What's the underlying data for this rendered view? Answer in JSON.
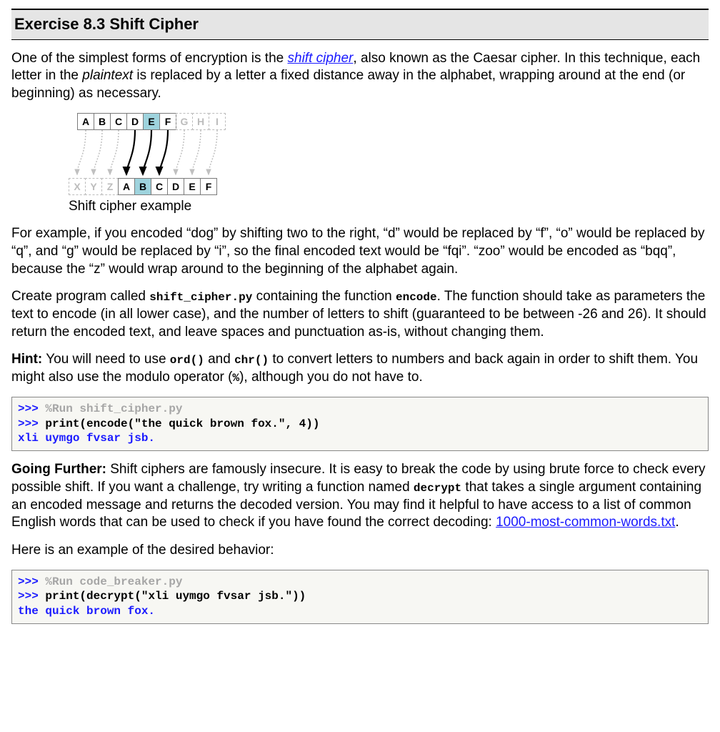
{
  "title": "Exercise 8.3 Shift Cipher",
  "para1": {
    "t1": "One of the simplest forms of encryption is the ",
    "link1": "shift cipher",
    "t2": ", also known as the Caesar cipher. In this technique, each letter in the ",
    "ital1": "plaintext",
    "t3": " is replaced by a letter a fixed distance away in the alphabet, wrapping around at the end (or beginning) as necessary."
  },
  "figure": {
    "top": [
      "A",
      "B",
      "C",
      "D",
      "E",
      "F",
      "G",
      "H",
      "I"
    ],
    "bot": [
      "X",
      "Y",
      "Z",
      "A",
      "B",
      "C",
      "D",
      "E",
      "F"
    ],
    "caption": "Shift cipher example"
  },
  "para2": "For example, if you encoded “dog” by shifting two to the right, “d” would be replaced by “f”, “o” would be replaced by “q”, and “g” would be replaced by “i”, so the final encoded text would be “fqi”. “zoo” would be encoded as “bqq”, because the “z” would wrap around to the beginning of the alphabet again.",
  "para3": {
    "t1": "Create program called ",
    "code1": "shift_cipher.py",
    "t2": " containing the function ",
    "code2": "encode",
    "t3": ". The function should take as parameters the text to encode (in all lower case), and the number of letters to shift (guaranteed to be between -26 and 26). It should return the encoded text, and leave spaces and punctuation as-is, without changing them."
  },
  "hint": {
    "label": "Hint:",
    "t1": " You will need to use ",
    "code1": "ord()",
    "t2": " and ",
    "code2": "chr()",
    "t3": " to convert letters to numbers and back again in order to shift them. You might also use the modulo operator (",
    "code3": "%",
    "t4": "), although you do not have to."
  },
  "code1": {
    "l1_prompt": ">>>",
    "l1_rest": " %Run shift_cipher.py",
    "l2_prompt": ">>>",
    "l2_rest": " print(encode(\"the quick brown fox.\", 4))",
    "l3": "xli uymgo fvsar jsb."
  },
  "further": {
    "label": "Going Further:",
    "t1": " Shift ciphers are famously insecure. It is easy to break the code by using brute force to check every possible shift. If you want a challenge, try writing a function named ",
    "code1": "decrypt",
    "t2": " that takes a single argument containing an encoded message and returns the decoded version. You may find it helpful to have access to a list of common English words that can be used to check if you have found the correct decoding: ",
    "link1": "1000-most-common-words.txt",
    "t3": "."
  },
  "example_label": "Here is an example of the desired behavior:",
  "code2": {
    "l1_prompt": ">>>",
    "l1_rest": " %Run code_breaker.py",
    "l2_prompt": ">>>",
    "l2_rest": " print(decrypt(\"xli uymgo fvsar jsb.\"))",
    "l3": "the quick brown fox."
  }
}
